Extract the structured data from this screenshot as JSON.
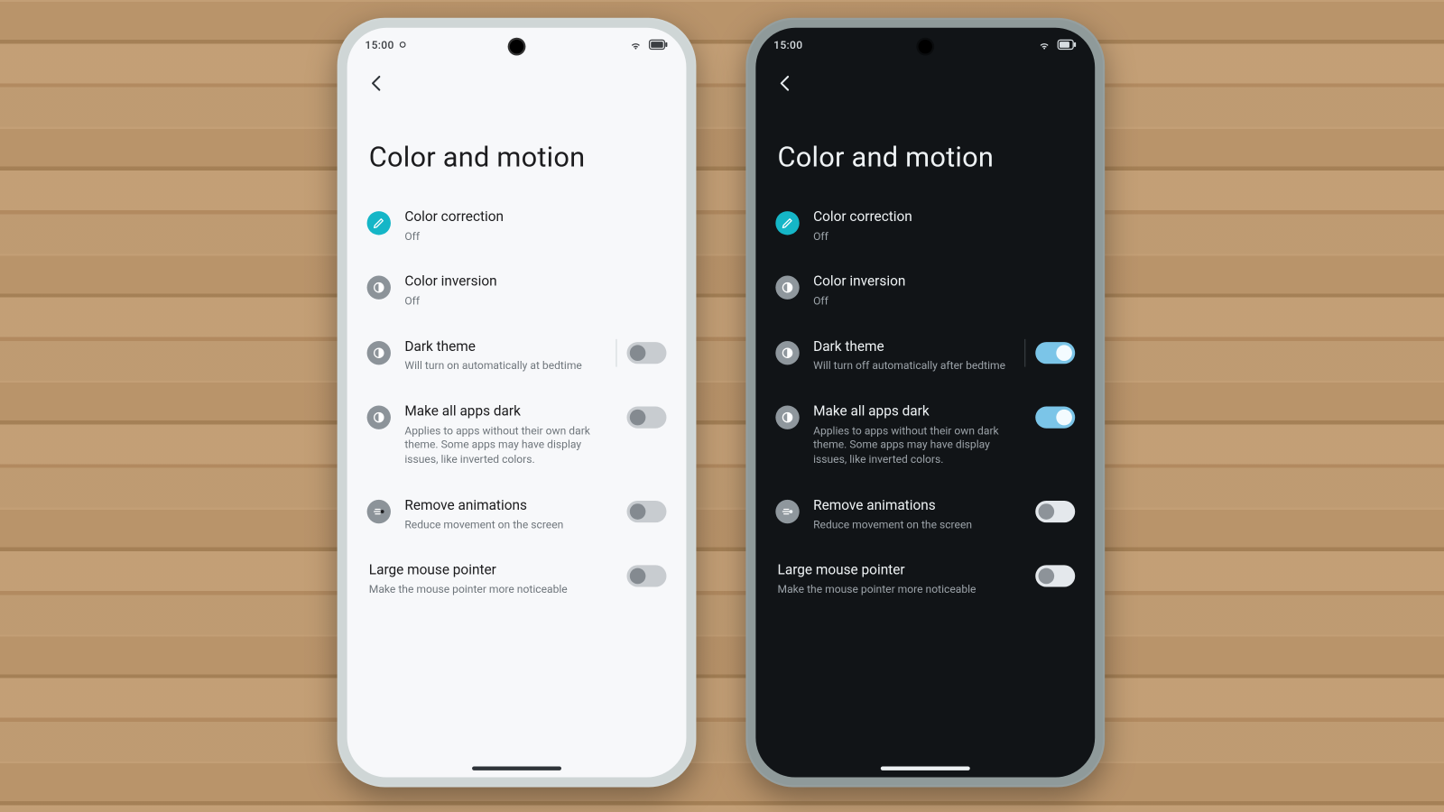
{
  "phones": [
    {
      "mode": "light",
      "status": {
        "time": "15:00"
      },
      "title": "Color and motion",
      "items": [
        {
          "id": "color-correction",
          "icon": "pencil",
          "iconStyle": "accent",
          "title": "Color correction",
          "sub": "Off"
        },
        {
          "id": "color-inversion",
          "icon": "contrast",
          "iconStyle": "muted",
          "title": "Color inversion",
          "sub": "Off"
        },
        {
          "id": "dark-theme",
          "icon": "contrast",
          "iconStyle": "muted",
          "title": "Dark theme",
          "sub": "Will turn on automatically at bedtime",
          "toggle": false,
          "sep": true
        },
        {
          "id": "make-all-dark",
          "icon": "contrast",
          "iconStyle": "muted",
          "title": "Make all apps dark",
          "sub": "Applies to apps without their own dark theme. Some apps may have display issues, like inverted colors.",
          "toggle": false
        },
        {
          "id": "remove-anim",
          "icon": "motion",
          "iconStyle": "muted",
          "title": "Remove animations",
          "sub": "Reduce movement on the screen",
          "toggle": false
        },
        {
          "id": "large-pointer",
          "icon": "",
          "iconStyle": "",
          "title": "Large mouse pointer",
          "sub": "Make the mouse pointer more noticeable",
          "toggle": false,
          "noicon": true
        }
      ]
    },
    {
      "mode": "dark",
      "status": {
        "time": "15:00"
      },
      "title": "Color and motion",
      "items": [
        {
          "id": "color-correction",
          "icon": "pencil",
          "iconStyle": "accent",
          "title": "Color correction",
          "sub": "Off"
        },
        {
          "id": "color-inversion",
          "icon": "contrast",
          "iconStyle": "muted",
          "title": "Color inversion",
          "sub": "Off"
        },
        {
          "id": "dark-theme",
          "icon": "contrast",
          "iconStyle": "muted",
          "title": "Dark theme",
          "sub": "Will turn off automatically after bedtime",
          "toggle": true,
          "sep": true
        },
        {
          "id": "make-all-dark",
          "icon": "contrast",
          "iconStyle": "muted",
          "title": "Make all apps dark",
          "sub": "Applies to apps without their own dark theme. Some apps may have display issues, like inverted colors.",
          "toggle": true
        },
        {
          "id": "remove-anim",
          "icon": "motion",
          "iconStyle": "muted",
          "title": "Remove animations",
          "sub": "Reduce movement on the screen",
          "toggle": false
        },
        {
          "id": "large-pointer",
          "icon": "",
          "iconStyle": "",
          "title": "Large mouse pointer",
          "sub": "Make the mouse pointer more noticeable",
          "toggle": false,
          "noicon": true
        }
      ]
    }
  ],
  "icons": {
    "back": "<svg viewBox='0 0 24 24' width='20' height='20' fill='none' stroke-width='2.2' stroke-linecap='round' stroke-linejoin='round'><path d='M15 4 L7 12 L15 20'/></svg>",
    "pencil": "<svg viewBox='0 0 24 24' stroke-width='2' stroke-linecap='round' stroke-linejoin='round'><path d='M4 20 L8 19 L19 8 L16 5 L5 16 Z'/></svg>",
    "contrast": "<svg viewBox='0 0 24 24'><circle cx='12' cy='12' r='8' fill='none' stroke-width='2'/><path d='M12 4 A8 8 0 0 1 12 20 Z'/></svg>",
    "motion": "<svg viewBox='0 0 24 24' stroke-width='2' stroke-linecap='round'><path d='M6 8 H14 M4 12 H16 M6 16 H14'/><circle cx='18' cy='12' r='3' fill='currentColor' stroke='none'/></svg>",
    "wifi": "<svg viewBox='0 0 24 24' width='14' height='14' fill='currentColor'><path d='M12 20c.8 0 1.5-.7 1.5-1.5S12.8 17 12 17s-1.5.7-1.5 1.5S11.2 20 12 20zm-4.2-4.2 1.4 1.4c1.5-1.5 4-1.5 5.6 0l1.4-1.4c-2.3-2.3-6.1-2.3-8.4 0zm-2.9-2.9 1.4 1.4c3.1-3.1 8.2-3.1 11.3 0l1.4-1.4c-3.9-3.9-10.3-3.9-14.1 0z'/></svg>",
    "battL": "<svg viewBox='0 0 26 14' width='20' height='12'><rect x='1' y='1' width='20' height='12' rx='3' fill='none' stroke='currentColor' stroke-width='1.5'/><rect x='22' y='4' width='2.5' height='6' rx='1' fill='currentColor'/><rect x='3' y='3' width='16' height='8' rx='1.5' fill='currentColor'/></svg>",
    "battD": "<svg viewBox='0 0 26 14' width='20' height='12'><rect x='1' y='1' width='20' height='12' rx='3' fill='none' stroke='currentColor' stroke-width='1.5'/><rect x='22' y='4' width='2.5' height='6' rx='1' fill='currentColor'/><rect x='3' y='3' width='13' height='8' rx='1.5' fill='currentColor'/></svg>",
    "dot": "<svg viewBox='0 0 10 10' width='8' height='8'><circle cx='5' cy='5' r='3.2' fill='none' stroke='currentColor' stroke-width='1.3'/></svg>"
  }
}
